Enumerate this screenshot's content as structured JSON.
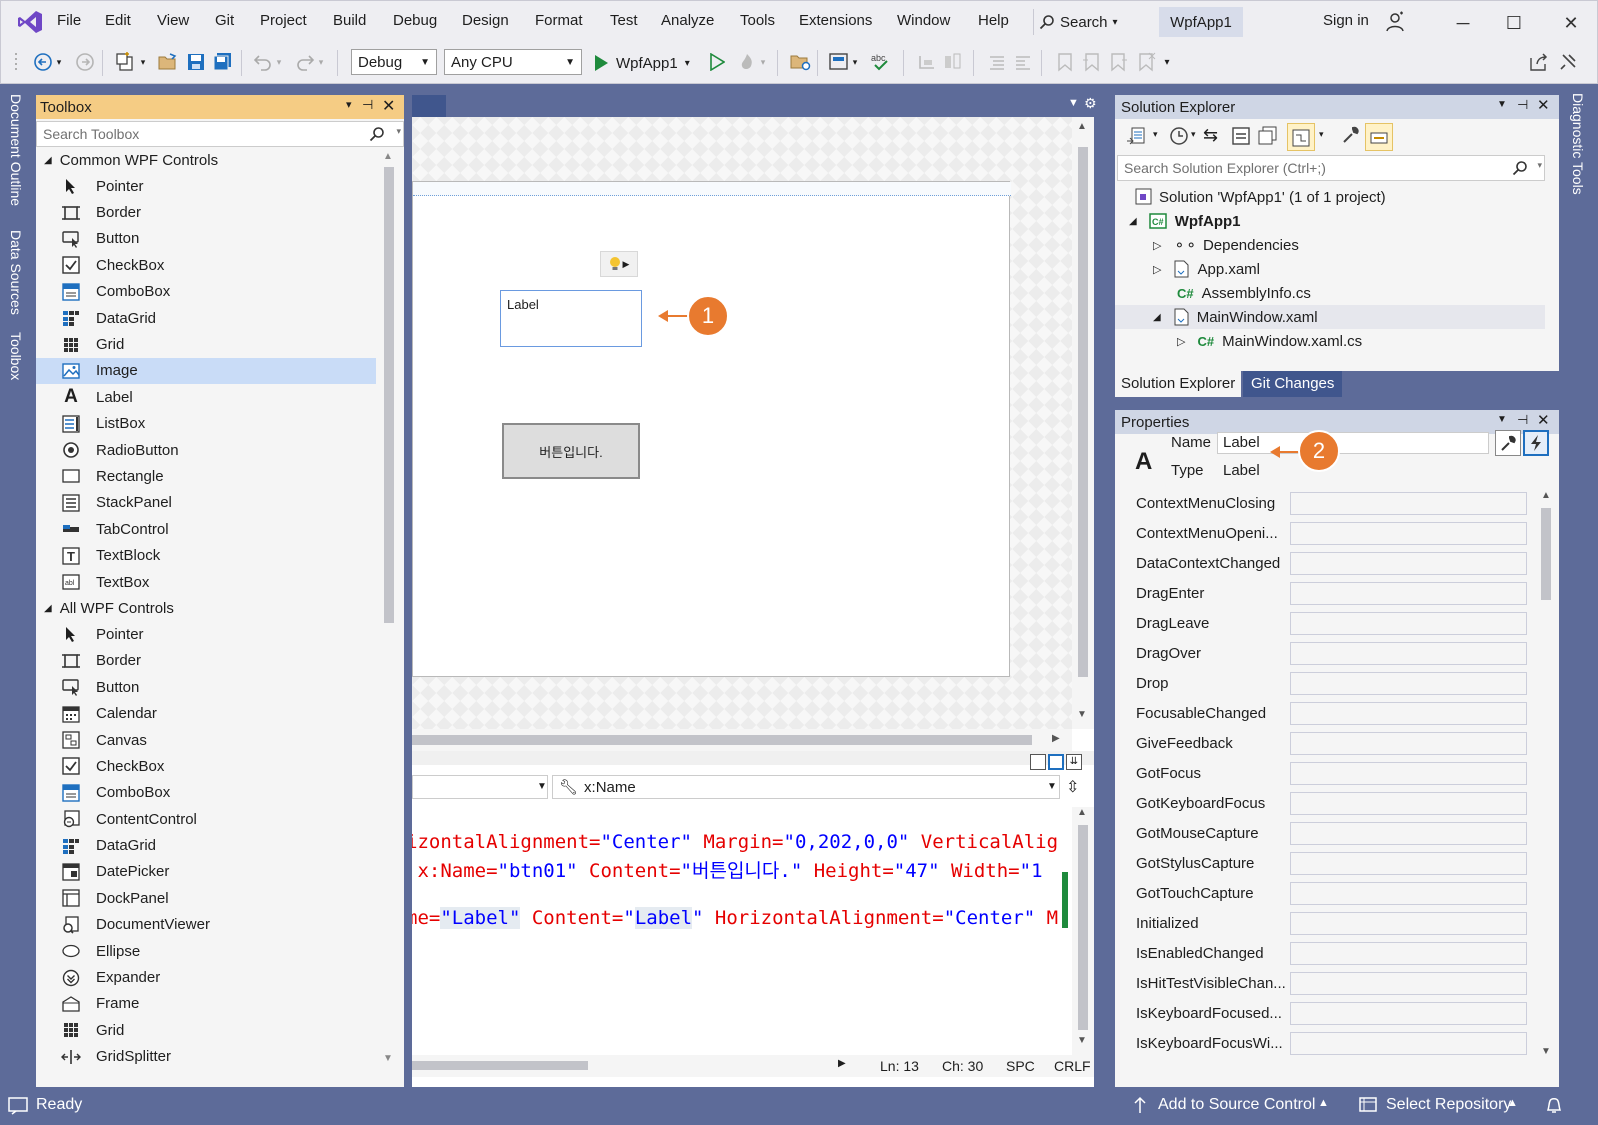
{
  "menu": [
    "File",
    "Edit",
    "View",
    "Git",
    "Project",
    "Build",
    "Debug",
    "Design",
    "Format",
    "Test",
    "Analyze",
    "Tools",
    "Extensions",
    "Window",
    "Help"
  ],
  "search_label": "Search",
  "app_title": "WpfApp1",
  "sign_in": "Sign in",
  "toolbar": {
    "config": "Debug",
    "platform": "Any CPU",
    "run_target": "WpfApp1"
  },
  "side_tabs": {
    "document_outline": "Document Outline",
    "data_sources": "Data Sources",
    "toolbox": "Toolbox",
    "diagnostic_tools": "Diagnostic Tools"
  },
  "toolbox": {
    "title": "Toolbox",
    "search_placeholder": "Search Toolbox",
    "group1": "Common WPF Controls",
    "group1_items": [
      "Pointer",
      "Border",
      "Button",
      "CheckBox",
      "ComboBox",
      "DataGrid",
      "Grid",
      "Image",
      "Label",
      "ListBox",
      "RadioButton",
      "Rectangle",
      "StackPanel",
      "TabControl",
      "TextBlock",
      "TextBox"
    ],
    "group2": "All WPF Controls",
    "group2_items": [
      "Pointer",
      "Border",
      "Button",
      "Calendar",
      "Canvas",
      "CheckBox",
      "ComboBox",
      "ContentControl",
      "DataGrid",
      "DatePicker",
      "DockPanel",
      "DocumentViewer",
      "Ellipse",
      "Expander",
      "Frame",
      "Grid",
      "GridSplitter"
    ]
  },
  "designer": {
    "label_text": "Label",
    "button_text": "버튼입니다.",
    "name_combo": "x:Name",
    "code": {
      "line1": {
        "a1": "izontalAlignment=",
        "v1": "\"Center\"",
        "a2": " Margin=",
        "v2": "\"0,202,0,0\"",
        "a3": " VerticalAlig"
      },
      "line2": {
        "a1": " x:Name=",
        "v1": "\"btn01\"",
        "a2": " Content=",
        "v2": "\"버튼입니다.\"",
        "a3": " Height=",
        "v3": "\"47\"",
        "a4": " Width=",
        "v4": "\"1"
      },
      "line3": {
        "a1": "me=",
        "v1": "\"Label\"",
        "a2": " Content=",
        "v2a": "\"",
        "v2b": "Label",
        "v2c": "\"",
        "a3": " HorizontalAlignment=",
        "v3": "\"Center\"",
        "a4": " M"
      }
    },
    "status": {
      "ln": "Ln: 13",
      "ch": "Ch: 30",
      "spc": "SPC",
      "crlf": "CRLF"
    }
  },
  "solution_explorer": {
    "title": "Solution Explorer",
    "search_placeholder": "Search Solution Explorer (Ctrl+;)",
    "solution": "Solution 'WpfApp1' (1 of 1 project)",
    "project": "WpfApp1",
    "items": [
      "Dependencies",
      "App.xaml",
      "AssemblyInfo.cs",
      "MainWindow.xaml",
      "MainWindow.xaml.cs"
    ],
    "tabs": [
      "Solution Explorer",
      "Git Changes"
    ]
  },
  "properties": {
    "title": "Properties",
    "name_label": "Name",
    "name_value": "Label",
    "type_label": "Type",
    "type_value": "Label",
    "events": [
      "ContextMenuClosing",
      "ContextMenuOpeni...",
      "DataContextChanged",
      "DragEnter",
      "DragLeave",
      "DragOver",
      "Drop",
      "FocusableChanged",
      "GiveFeedback",
      "GotFocus",
      "GotKeyboardFocus",
      "GotMouseCapture",
      "GotStylusCapture",
      "GotTouchCapture",
      "Initialized",
      "IsEnabledChanged",
      "IsHitTestVisibleChan...",
      "IsKeyboardFocused...",
      "IsKeyboardFocusWi..."
    ]
  },
  "callouts": {
    "one": "1",
    "two": "2"
  },
  "statusbar": {
    "ready": "Ready",
    "source_control": "Add to Source Control",
    "repository": "Select Repository"
  }
}
